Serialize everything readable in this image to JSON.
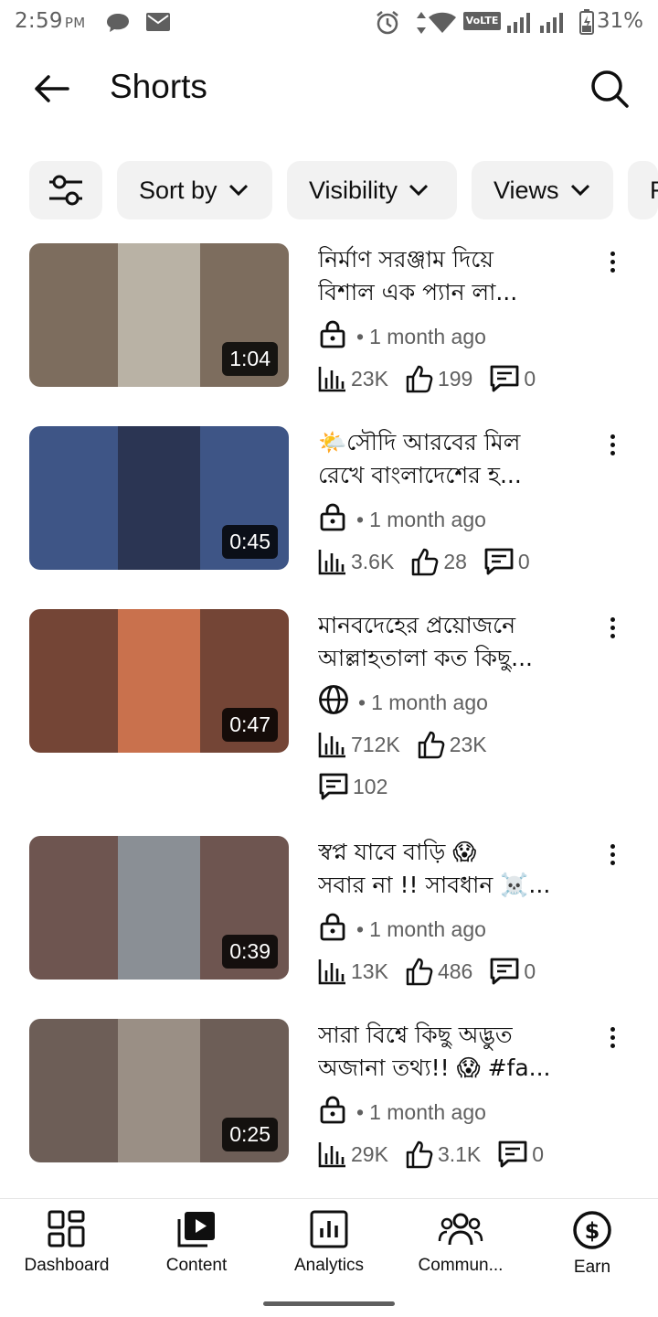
{
  "status_bar": {
    "time": "2:59",
    "ampm": "PM",
    "network_badge": "VoLTE",
    "battery": "31%"
  },
  "header": {
    "title": "Shorts"
  },
  "filters": [
    {
      "label": "Sort by"
    },
    {
      "label": "Visibility"
    },
    {
      "label": "Views"
    },
    {
      "label": "F"
    }
  ],
  "videos": [
    {
      "title_line1": "নির্মাণ সরঞ্জাম দিয়ে",
      "title_line2": "বিশাল এক প্যান লা...",
      "duration": "1:04",
      "visibility": "private",
      "age": "1 month ago",
      "views": "23K",
      "likes": "199",
      "comments": "0",
      "colors": {
        "side": "#7d6d5e",
        "center": "#b9b2a5"
      }
    },
    {
      "title_line1": "🌤️সৌদি আরবের মিল",
      "title_line2": "রেখে বাংলাদেশের হ...",
      "duration": "0:45",
      "visibility": "private",
      "age": "1 month ago",
      "views": "3.6K",
      "likes": "28",
      "comments": "0",
      "colors": {
        "side": "#3e5586",
        "center": "#2b3553"
      }
    },
    {
      "title_line1": "মানবদেহের প্রয়োজনে",
      "title_line2": "আল্লাহতালা কত কিছু...",
      "duration": "0:47",
      "visibility": "public",
      "age": "1 month ago",
      "views": "712K",
      "likes": "23K",
      "comments": "102",
      "colors": {
        "side": "#744536",
        "center": "#c9714d"
      }
    },
    {
      "title_line1": "স্বপ্ন যাবে বাড়ি 😱",
      "title_line2": "সবার না !! সাবধান ☠️...",
      "duration": "0:39",
      "visibility": "private",
      "age": "1 month ago",
      "views": "13K",
      "likes": "486",
      "comments": "0",
      "colors": {
        "side": "#6e5550",
        "center": "#8a8f95"
      }
    },
    {
      "title_line1": "সারা বিশ্বে কিছু অদ্ভুত",
      "title_line2": "অজানা তথ্য!! 😱 #fa...",
      "duration": "0:25",
      "visibility": "private",
      "age": "1 month ago",
      "views": "29K",
      "likes": "3.1K",
      "comments": "0",
      "colors": {
        "side": "#6d5e57",
        "center": "#9a8f85"
      }
    }
  ],
  "bottom_nav": [
    {
      "label": "Dashboard",
      "icon": "dashboard-icon"
    },
    {
      "label": "Content",
      "icon": "content-icon"
    },
    {
      "label": "Analytics",
      "icon": "analytics-icon"
    },
    {
      "label": "Commun...",
      "icon": "community-icon"
    },
    {
      "label": "Earn",
      "icon": "earn-icon"
    }
  ]
}
